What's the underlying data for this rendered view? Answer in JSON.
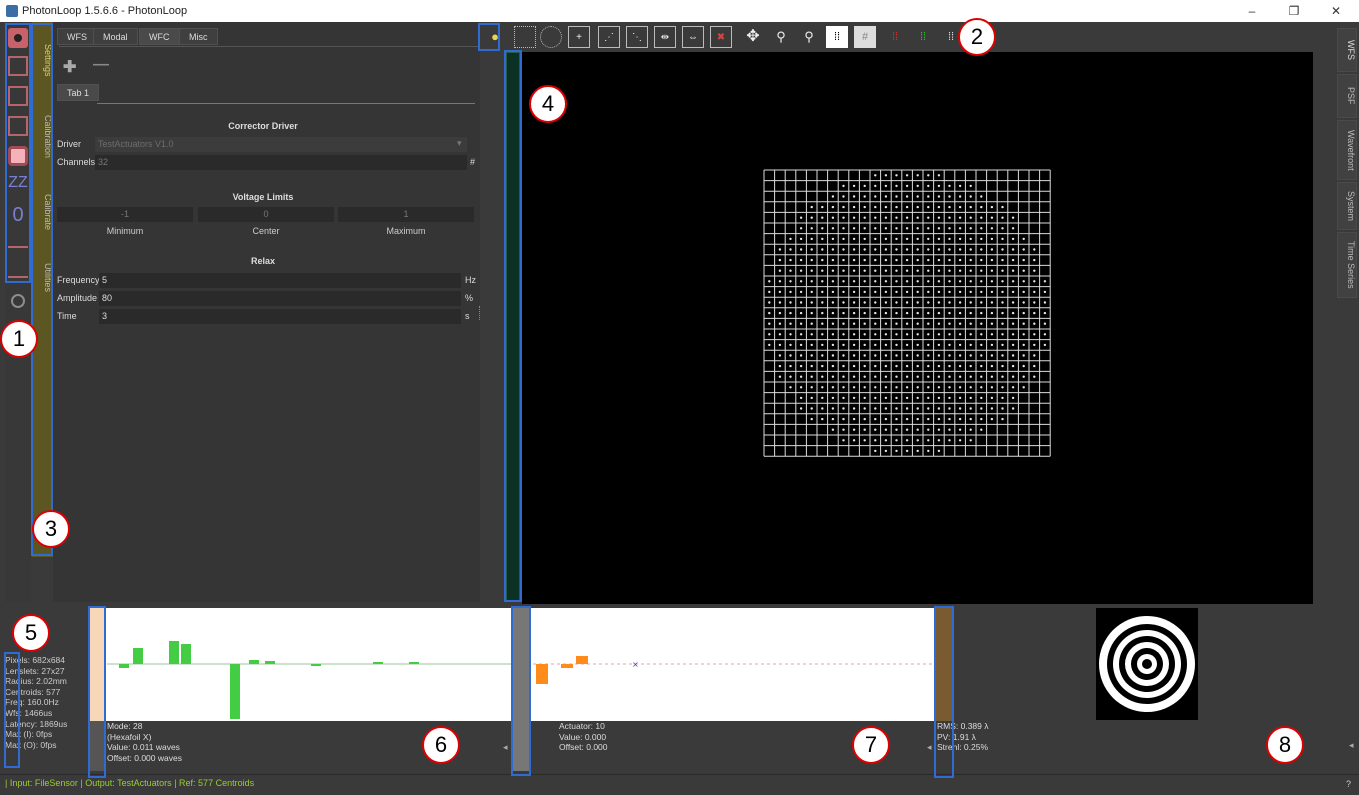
{
  "window": {
    "title": "PhotonLoop 1.5.6.6 - PhotonLoop",
    "minimize": "–",
    "restore": "❐",
    "close": "✕"
  },
  "left_vertical_tabs": [
    "Settings",
    "Calibration",
    "Calibrate",
    "Utilities"
  ],
  "top_tabs": [
    "WFS",
    "Modal",
    "WFC",
    "Misc"
  ],
  "active_top_tab": "WFC",
  "add_icon": "plus-icon",
  "remove_icon": "minus-icon",
  "sub_tab": "Tab 1",
  "corrector": {
    "section": "Corrector Driver",
    "driver_label": "Driver",
    "driver_value": "TestActuators V1.0",
    "channels_label": "Channels",
    "channels_value": "32",
    "channels_unit": "#"
  },
  "voltage": {
    "section": "Voltage Limits",
    "minimum": "-1",
    "center": "0",
    "maximum": "1",
    "min_label": "Minimum",
    "center_label": "Center",
    "max_label": "Maximum"
  },
  "relax": {
    "section": "Relax",
    "frequency_label": "Frequency",
    "frequency_value": "5",
    "frequency_unit": "Hz",
    "amplitude_label": "Amplitude",
    "amplitude_value": "80",
    "amplitude_unit": "%",
    "time_label": "Time",
    "time_value": "3",
    "time_unit": "s"
  },
  "right_vertical_tabs": [
    "WFS",
    "PSF",
    "Wavefront",
    "System",
    "Time Series"
  ],
  "stats": [
    "Pixels: 682x684",
    "Lenslets: 27x27",
    "Radius: 2.02mm",
    "Centroids: 577",
    "Freq: 160.0Hz",
    "Wfs: 1466us",
    "Latency: 1869us",
    "Max (I): 0fps",
    "Max (O): 0fps"
  ],
  "mode_info": [
    "Mode: 28",
    "(Hexafoil X)",
    "Value: 0.011 waves",
    "Offset: 0.000 waves"
  ],
  "actuator_info": [
    "Actuator: 10",
    "Value: 0.000",
    "Offset: 0.000"
  ],
  "rms_info": [
    "RMS: 0.389 λ",
    "PV: 1.91 λ",
    "Strehl: 0.25%"
  ],
  "status": {
    "input": "Input: FileSensor",
    "output": "Output: TestActuators",
    "ref": "Ref: 577 Centroids",
    "sep": "|"
  },
  "markers": [
    "1",
    "2",
    "3",
    "4",
    "5",
    "6",
    "7",
    "8"
  ],
  "help": "?"
}
